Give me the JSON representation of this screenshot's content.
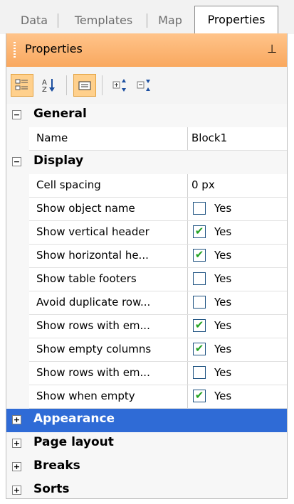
{
  "tabs": [
    "Data",
    "Templates",
    "Map",
    "Properties"
  ],
  "panel": {
    "title": "Properties"
  },
  "categories": {
    "general": "General",
    "display": "Display",
    "appearance": "Appearance",
    "page_layout": "Page layout",
    "breaks": "Breaks",
    "sorts": "Sorts"
  },
  "general": {
    "name_label": "Name",
    "name_value": "Block1"
  },
  "display": [
    {
      "label": "Cell spacing",
      "value": "0 px"
    },
    {
      "label": "Show object name",
      "value": "Yes",
      "checked": false
    },
    {
      "label": "Show vertical header",
      "value": "Yes",
      "checked": true
    },
    {
      "label": "Show horizontal he...",
      "value": "Yes",
      "checked": true
    },
    {
      "label": "Show table footers",
      "value": "Yes",
      "checked": false
    },
    {
      "label": "Avoid duplicate row...",
      "value": "Yes",
      "checked": false
    },
    {
      "label": "Show rows with em...",
      "value": "Yes",
      "checked": true
    },
    {
      "label": "Show empty columns",
      "value": "Yes",
      "checked": true
    },
    {
      "label": "Show rows with em...",
      "value": "Yes",
      "checked": false
    },
    {
      "label": "Show when empty",
      "value": "Yes",
      "checked": true
    }
  ],
  "colors": {
    "selected": "#2f6bd6",
    "header": "#f9a85f",
    "check": "#21a121"
  }
}
